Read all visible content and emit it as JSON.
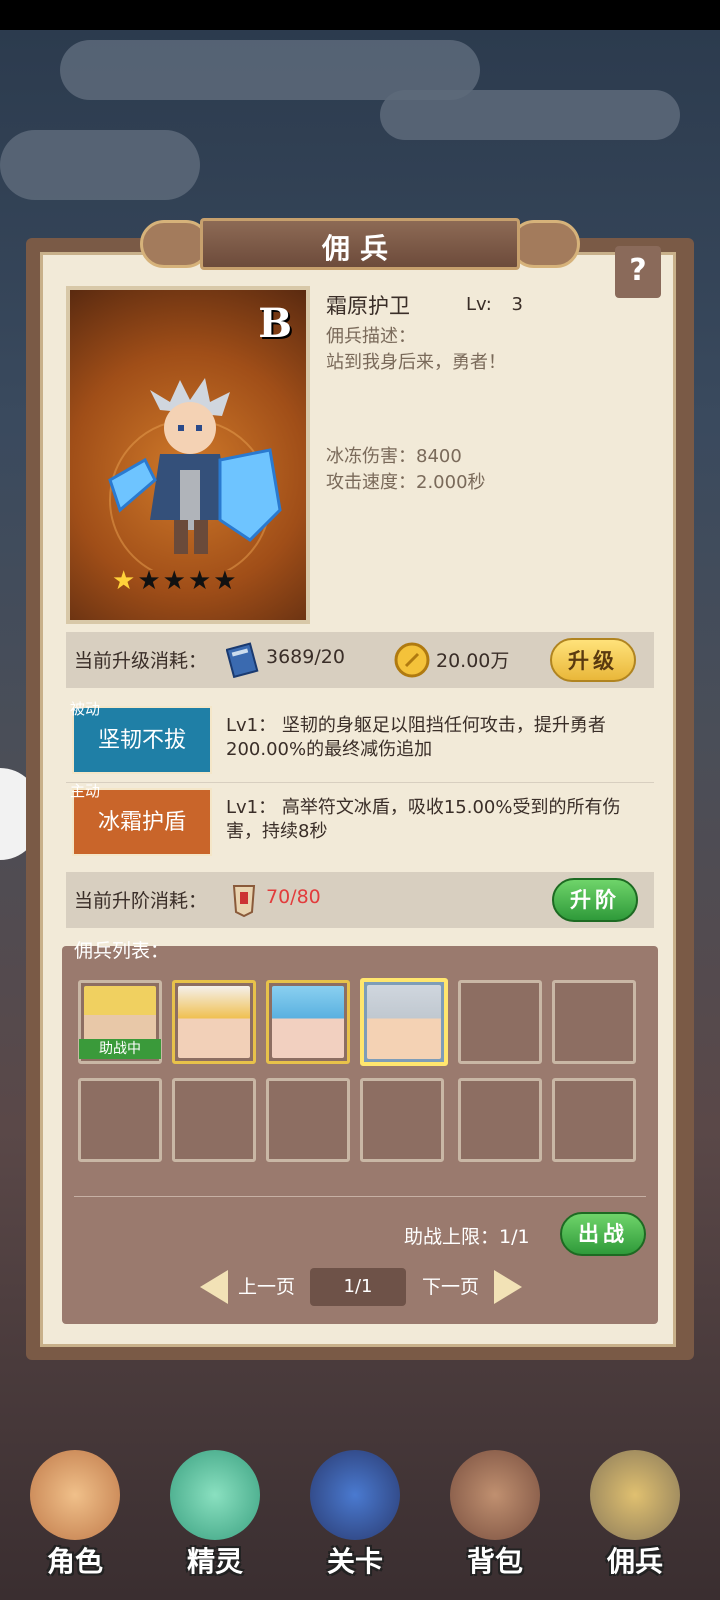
{
  "window": {
    "title": "佣兵",
    "help_label": "?"
  },
  "mercenary": {
    "grade": "B",
    "name": "霜原护卫",
    "level_label": "Lv:",
    "level": "3",
    "desc_label": "佣兵描述：",
    "desc": "站到我身后来，勇者！",
    "stat_damage": "冰冻伤害：8400",
    "stat_speed": "攻击速度：2.000秒",
    "stars_total": 5,
    "stars_filled": 1
  },
  "upgrade": {
    "label": "当前升级消耗：",
    "book_count": "3689/20",
    "gold_count": "20.00万",
    "button": "升级"
  },
  "skills": [
    {
      "type": "被动",
      "name": "坚韧不拔",
      "desc": "Lv1： 坚韧的身躯足以阻挡任何攻击，提升勇者200.00%的最终减伤追加",
      "color": "#1f7fa6"
    },
    {
      "type": "主动",
      "name": "冰霜护盾",
      "desc": "Lv1： 高举符文冰盾，吸收15.00%受到的所有伤害，持续8秒",
      "color": "#c9652a"
    }
  ],
  "advance": {
    "label": "当前升阶消耗：",
    "count": "70/80",
    "button": "升阶"
  },
  "list": {
    "title": "佣兵列表：",
    "assist_badge": "助战中",
    "assist_limit": "助战上限：1/1",
    "battle_button": "出战",
    "prev": "上一页",
    "next": "下一页",
    "page": "1/1"
  },
  "nav": [
    {
      "label": "角色",
      "icon": "character-icon"
    },
    {
      "label": "精灵",
      "icon": "spirit-icon"
    },
    {
      "label": "关卡",
      "icon": "stage-icon"
    },
    {
      "label": "背包",
      "icon": "bag-icon"
    },
    {
      "label": "佣兵",
      "icon": "mercenary-icon"
    }
  ]
}
